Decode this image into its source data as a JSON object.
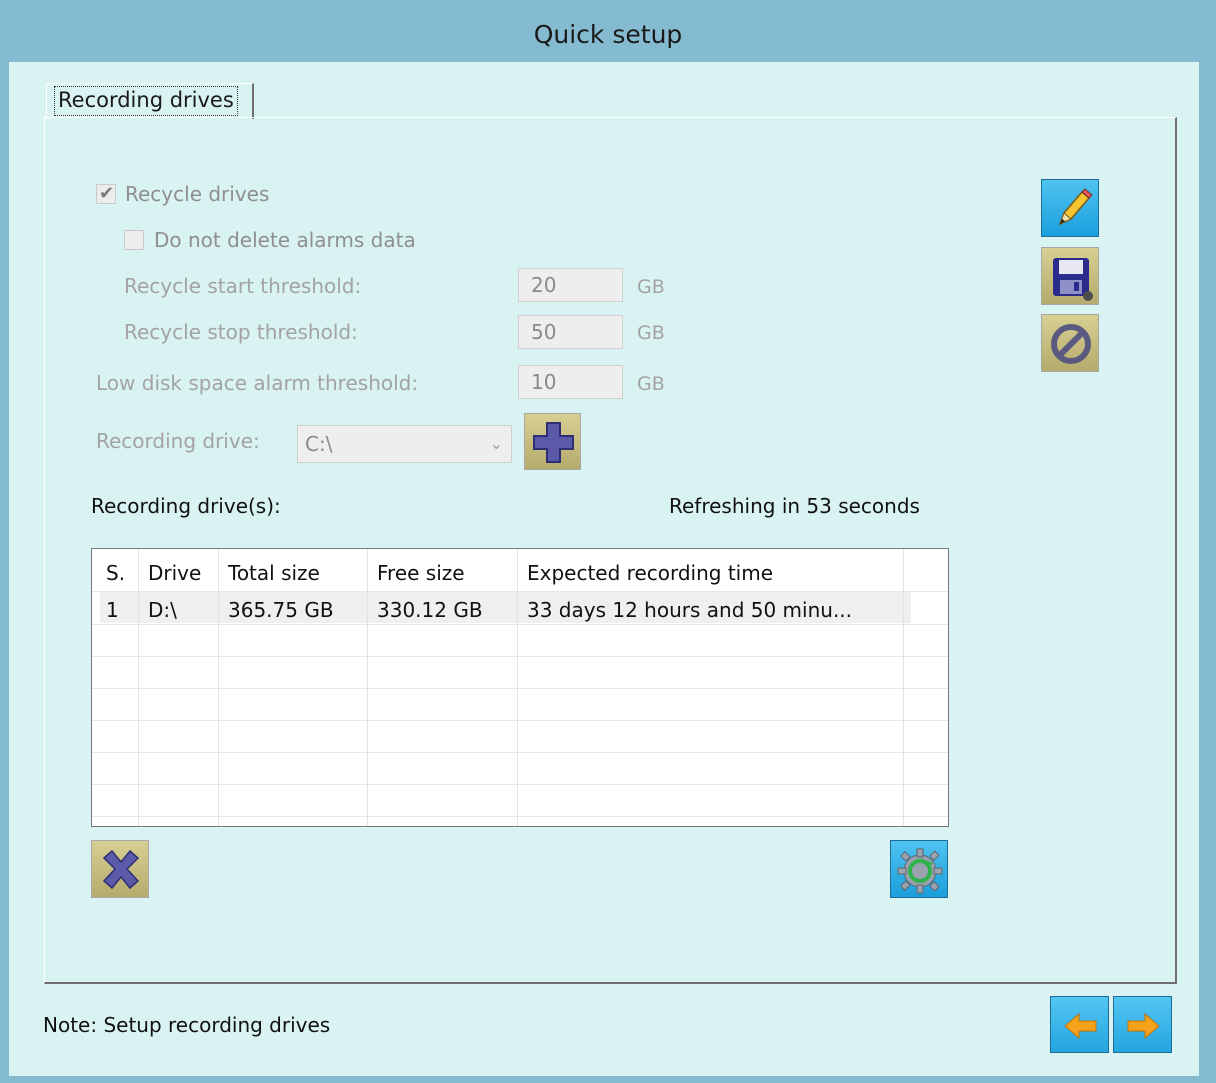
{
  "window": {
    "title": "Quick setup"
  },
  "tab": {
    "label": "Recording drives"
  },
  "recycle": {
    "checkbox_label": "Recycle drives",
    "checked": true,
    "no_delete_alarms_label": "Do not delete alarms data",
    "no_delete_alarms_checked": false
  },
  "thresholds": {
    "start_label": "Recycle start threshold:",
    "start_value": "20",
    "stop_label": "Recycle stop threshold:",
    "stop_value": "50",
    "low_disk_label": "Low disk space alarm threshold:",
    "low_disk_value": "10",
    "unit": "GB"
  },
  "drive": {
    "label": "Recording drive:",
    "selected": "C:\\"
  },
  "list": {
    "title": "Recording drive(s):",
    "refresh_status": "Refreshing in 53 seconds",
    "columns": [
      "S.",
      "Drive",
      "Total size",
      "Free size",
      "Expected recording time"
    ],
    "rows": [
      {
        "s": "1",
        "drive": "D:\\",
        "total": "365.75 GB",
        "free": "330.12 GB",
        "expected": "33 days 12 hours and 50 minu..."
      }
    ]
  },
  "note": "Note: Setup recording drives",
  "icons": {
    "edit": "pencil-icon",
    "save": "floppy-disk-icon",
    "cancel": "no-entry-icon",
    "add": "plus-icon",
    "delete": "x-icon",
    "refresh": "refresh-gear-icon",
    "back": "arrow-left-icon",
    "next": "arrow-right-icon"
  },
  "colors": {
    "titlebar": "#85bbd0",
    "client": "#d9f2f2",
    "active_button": "#1a9fdc",
    "muted_button": "#b5ab6c",
    "nav_arrow": "#f7a21b"
  }
}
